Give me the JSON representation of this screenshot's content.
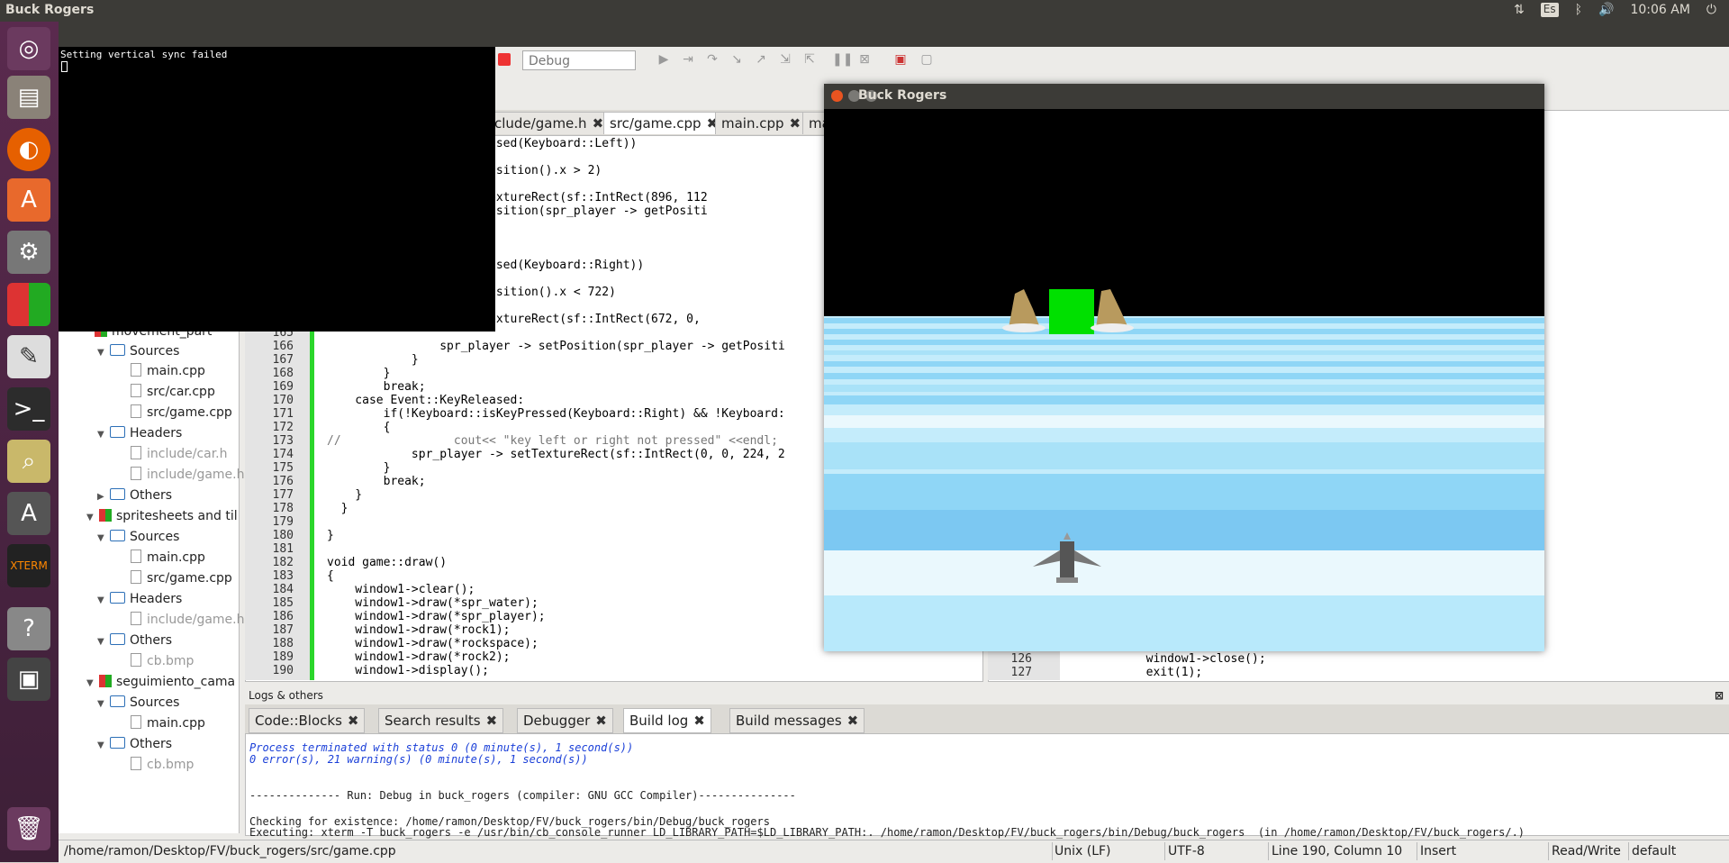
{
  "top_panel": {
    "title": "Buck Rogers",
    "keyboard": "Es",
    "time": "10:06 AM"
  },
  "launcher": {
    "icons": [
      "ubuntu-logo-icon",
      "files-icon",
      "firefox-icon",
      "software-center-icon",
      "settings-icon",
      "codeblocks-icon",
      "text-editor-icon",
      "terminal-icon",
      "image-viewer-icon",
      "software-updater-icon",
      "xterm-icon",
      "help-icon",
      "save-icon",
      "trash-icon"
    ]
  },
  "codeblocks": {
    "window_title": "buck_rogers",
    "build_target": "Debug",
    "editor_tabs": [
      {
        "label": "clude/game.h"
      },
      {
        "label": "src/game.cpp"
      },
      {
        "label": "main.cpp"
      },
      {
        "label": "ma"
      }
    ],
    "tree": [
      {
        "label": "movement_part",
        "kind": "project",
        "indent": 0
      },
      {
        "label": "Sources",
        "kind": "folder",
        "indent": 1
      },
      {
        "label": "main.cpp",
        "kind": "file",
        "indent": 2
      },
      {
        "label": "src/car.cpp",
        "kind": "file",
        "indent": 2
      },
      {
        "label": "src/game.cpp",
        "kind": "file",
        "indent": 2
      },
      {
        "label": "Headers",
        "kind": "folder",
        "indent": 1
      },
      {
        "label": "include/car.h",
        "kind": "file-gray",
        "indent": 2
      },
      {
        "label": "include/game.h",
        "kind": "file-gray",
        "indent": 2
      },
      {
        "label": "Others",
        "kind": "folder-closed",
        "indent": 1
      },
      {
        "label": "spritesheets and til",
        "kind": "project",
        "indent": 0
      },
      {
        "label": "Sources",
        "kind": "folder",
        "indent": 1
      },
      {
        "label": "main.cpp",
        "kind": "file",
        "indent": 2
      },
      {
        "label": "src/game.cpp",
        "kind": "file",
        "indent": 2
      },
      {
        "label": "Headers",
        "kind": "folder",
        "indent": 1
      },
      {
        "label": "include/game.h",
        "kind": "file-gray",
        "indent": 2
      },
      {
        "label": "Others",
        "kind": "folder",
        "indent": 1
      },
      {
        "label": "cb.bmp",
        "kind": "file-gray",
        "indent": 2
      },
      {
        "label": "seguimiento_cama",
        "kind": "project",
        "indent": 0
      },
      {
        "label": "Sources",
        "kind": "folder",
        "indent": 1
      },
      {
        "label": "main.cpp",
        "kind": "file",
        "indent": 2
      },
      {
        "label": "Others",
        "kind": "folder",
        "indent": 1
      },
      {
        "label": "cb.bmp",
        "kind": "file-gray",
        "indent": 2
      }
    ],
    "code_lines": [
      {
        "n": "",
        "text": "        board::isKeyPressed(Keyboard::Left))"
      },
      {
        "n": "",
        "text": ""
      },
      {
        "n": "",
        "text": "        _player -> getPosition().x > 2)"
      },
      {
        "n": "",
        "text": ""
      },
      {
        "n": "",
        "text": "        _player -> setTextureRect(sf::IntRect(896, 112"
      },
      {
        "n": "",
        "text": "        _player -> setPosition(spr_player -> getPositi"
      },
      {
        "n": "",
        "text": ""
      },
      {
        "n": "",
        "text": ""
      },
      {
        "n": "",
        "text": ""
      },
      {
        "n": "",
        "text": "        board::isKeyPressed(Keyboard::Right))"
      },
      {
        "n": "",
        "text": ""
      },
      {
        "n": "",
        "text": "        _player -> getPosition().x < 722)"
      },
      {
        "n": "",
        "text": ""
      },
      {
        "n": "",
        "text": "        _player -> setTextureRect(sf::IntRect(672, 0,"
      },
      {
        "n": "165",
        "text": ""
      },
      {
        "n": "166",
        "text": "                spr_player -> setPosition(spr_player -> getPositi"
      },
      {
        "n": "167",
        "text": "            }"
      },
      {
        "n": "168",
        "text": "        }"
      },
      {
        "n": "169",
        "text": "        break;"
      },
      {
        "n": "170",
        "text": "    case Event::KeyReleased:"
      },
      {
        "n": "171",
        "text": "        if(!Keyboard::isKeyPressed(Keyboard::Right) && !Keyboard:"
      },
      {
        "n": "172",
        "text": "        {"
      },
      {
        "n": "173",
        "text": "//                cout<< \"key left or right not pressed\" <<endl;"
      },
      {
        "n": "174",
        "text": "            spr_player -> setTextureRect(sf::IntRect(0, 0, 224, 2"
      },
      {
        "n": "175",
        "text": "        }"
      },
      {
        "n": "176",
        "text": "        break;"
      },
      {
        "n": "177",
        "text": "    }"
      },
      {
        "n": "178",
        "text": "  }"
      },
      {
        "n": "179",
        "text": ""
      },
      {
        "n": "180",
        "text": "}"
      },
      {
        "n": "181",
        "text": ""
      },
      {
        "n": "182",
        "text": "void game::draw()"
      },
      {
        "n": "183",
        "text": "{"
      },
      {
        "n": "184",
        "text": "    window1->clear();"
      },
      {
        "n": "185",
        "text": "    window1->draw(*spr_water);"
      },
      {
        "n": "186",
        "text": "    window1->draw(*spr_player);"
      },
      {
        "n": "187",
        "text": "    window1->draw(*rock1);"
      },
      {
        "n": "188",
        "text": "    window1->draw(*rockspace);"
      },
      {
        "n": "189",
        "text": "    window1->draw(*rock2);"
      },
      {
        "n": "190",
        "text": "    window1->display();"
      }
    ],
    "editor2_lines": [
      {
        "n": "126",
        "text": "        window1->close();"
      },
      {
        "n": "127",
        "text": "        exit(1);"
      }
    ],
    "logs_title": "Logs & others",
    "log_tabs": [
      "Code::Blocks",
      "Search results",
      "Debugger",
      "Build log",
      "Build messages"
    ],
    "log_lines": [
      "Process terminated with status 0 (0 minute(s), 1 second(s))",
      "0 error(s), 21 warning(s) (0 minute(s), 1 second(s))",
      "",
      "",
      "-------------- Run: Debug in buck_rogers (compiler: GNU GCC Compiler)---------------",
      "",
      "Checking for existence: /home/ramon/Desktop/FV/buck_rogers/bin/Debug/buck_rogers",
      "Executing: xterm -T buck_rogers -e /usr/bin/cb_console_runner LD_LIBRARY_PATH=$LD_LIBRARY_PATH:. /home/ramon/Desktop/FV/buck_rogers/bin/Debug/buck_rogers  (in /home/ramon/Desktop/FV/buck_rogers/.)"
    ],
    "status": {
      "path": "/home/ramon/Desktop/FV/buck_rogers/src/game.cpp",
      "eol": "Unix (LF)",
      "encoding": "UTF-8",
      "position": "Line 190, Column 10",
      "mode": "Insert",
      "access": "Read/Write",
      "profile": "default"
    }
  },
  "terminal": {
    "line1": "Setting vertical sync failed"
  },
  "game": {
    "title": "Buck Rogers",
    "colors": {
      "sky": "#000000",
      "water_light": "#c4ecfb",
      "water_mid": "#8fd6f6",
      "water_dark": "#7cc8f2",
      "box": "#00e000"
    }
  }
}
